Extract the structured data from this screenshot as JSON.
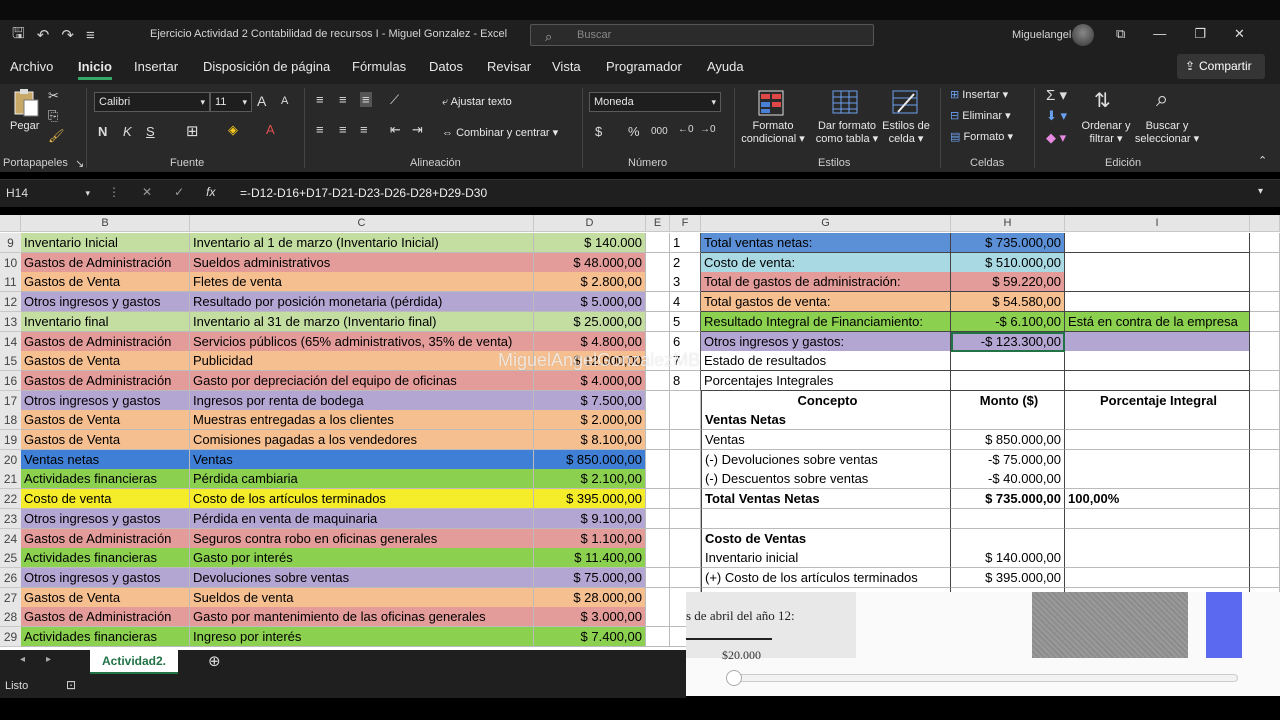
{
  "window": {
    "title": "Ejercicio Actividad 2 Contabilidad de recursos I - Miguel Gonzalez - Excel",
    "search_placeholder": "Buscar",
    "user": "Miguelangel Gz"
  },
  "menu": {
    "tabs": [
      "Archivo",
      "Inicio",
      "Insertar",
      "Disposición de página",
      "Fórmulas",
      "Datos",
      "Revisar",
      "Vista",
      "Programador",
      "Ayuda"
    ],
    "share": "Compartir"
  },
  "ribbon": {
    "paste": "Pegar",
    "font_name": "Calibri",
    "font_size": "11",
    "bold": "N",
    "italic": "K",
    "underline": "S",
    "wrap_text": "Ajustar texto",
    "merge_center": "Combinar y centrar",
    "number_format": "Moneda",
    "cond_format": [
      "Formato",
      "condicional"
    ],
    "format_table": [
      "Dar formato",
      "como tabla"
    ],
    "cell_styles": [
      "Estilos de",
      "celda"
    ],
    "insert": "Insertar",
    "delete": "Eliminar",
    "format": "Formato",
    "sort_filter": [
      "Ordenar y",
      "filtrar"
    ],
    "find_select": [
      "Buscar y",
      "seleccionar"
    ],
    "groups": [
      "Portapapeles",
      "Fuente",
      "Alineación",
      "Número",
      "Estilos",
      "Celdas",
      "Edición"
    ]
  },
  "formula_bar": {
    "name_box": "H14",
    "fx": "fx",
    "formula": "=-D12-D16+D17-D21-D23-D26-D28+D29-D30"
  },
  "columns": [
    "B",
    "C",
    "D",
    "E",
    "F",
    "G",
    "H",
    "I"
  ],
  "rows": [
    {
      "num": "9",
      "b": "Inventario Inicial",
      "c": "Inventario al 1 de marzo (Inventario Inicial)",
      "d": "$ 140.000",
      "color": "#c4dea2",
      "f": "1",
      "g": "Total ventas netas:",
      "h": "$ 735.000,00",
      "i": "",
      "gcolor": "#5b8fd6"
    },
    {
      "num": "10",
      "b": "Gastos de Administración",
      "c": "Sueldos administrativos",
      "d": "$ 48.000,00",
      "color": "#e39c99",
      "f": "2",
      "g": "Costo de venta:",
      "h": "$ 510.000,00",
      "i": "",
      "gcolor": "#a9d9e3"
    },
    {
      "num": "11",
      "b": "Gastos de Venta",
      "c": "Fletes de venta",
      "d": "$ 2.800,00",
      "color": "#f5bf90",
      "f": "3",
      "g": "Total de gastos de administración:",
      "h": "$ 59.220,00",
      "i": "",
      "gcolor": "#e39c99"
    },
    {
      "num": "12",
      "b": "Otros ingresos y gastos",
      "c": "Resultado por posición monetaria (pérdida)",
      "d": "$ 5.000,00",
      "color": "#b4a6d3",
      "f": "4",
      "g": "Total gastos de venta:",
      "h": "$ 54.580,00",
      "i": "",
      "gcolor": "#f5bf90"
    },
    {
      "num": "13",
      "b": "Inventario final",
      "c": "Inventario al 31 de marzo (Inventario final)",
      "d": "$ 25.000,00",
      "color": "#c4dea2",
      "f": "5",
      "g": "Resultado Integral de Financiamiento:",
      "h": "-$ 6.100,00",
      "i": "Está en contra de la empresa",
      "gcolor": "#8bd04f"
    },
    {
      "num": "14",
      "b": "Gastos de Administración",
      "c": "Servicios públicos (65% administrativos, 35% de venta)",
      "d": "$ 4.800,00",
      "color": "#e39c99",
      "f": "6",
      "g": "Otros ingresos y gastos:",
      "h": "-$ 123.300,00",
      "i": "",
      "gcolor": "#b4a6d3"
    },
    {
      "num": "15",
      "b": "Gastos de Venta",
      "c": "Publicidad",
      "d": "$ 12.000,00",
      "color": "#f5bf90",
      "f": "7",
      "g": "Estado de resultados",
      "h": "",
      "i": "",
      "gcolor": "#ffffff"
    },
    {
      "num": "16",
      "b": "Gastos de Administración",
      "c": "Gasto por depreciación del equipo de oficinas",
      "d": "$ 4.000,00",
      "color": "#e39c99",
      "f": "8",
      "g": "Porcentajes Integrales",
      "h": "",
      "i": "",
      "gcolor": "#ffffff"
    },
    {
      "num": "17",
      "b": "Otros ingresos y gastos",
      "c": "Ingresos por renta de bodega",
      "d": "$ 7.500,00",
      "color": "#b4a6d3",
      "f": "",
      "g": "Concepto",
      "h": "Monto ($)",
      "i": "Porcentaje Integral",
      "gcolor": "#ffffff"
    },
    {
      "num": "18",
      "b": "Gastos de Venta",
      "c": "Muestras entregadas a los clientes",
      "d": "$ 2.000,00",
      "color": "#f5bf90",
      "f": "",
      "g": "Ventas Netas",
      "h": "",
      "i": "",
      "gcolor": "#ffffff"
    },
    {
      "num": "19",
      "b": "Gastos de Venta",
      "c": "Comisiones pagadas a los vendedores",
      "d": "$ 8.100,00",
      "color": "#f5bf90",
      "f": "",
      "g": "Ventas",
      "h": "$ 850.000,00",
      "i": "",
      "gcolor": "#ffffff"
    },
    {
      "num": "20",
      "b": "Ventas netas",
      "c": "Ventas",
      "d": "$ 850.000,00",
      "color": "#3f7fd6",
      "f": "",
      "g": "(-) Devoluciones sobre ventas",
      "h": "-$ 75.000,00",
      "i": "",
      "gcolor": "#ffffff"
    },
    {
      "num": "21",
      "b": "Actividades financieras",
      "c": "Pérdida cambiaria",
      "d": "$ 2.100,00",
      "color": "#8bd04f",
      "f": "",
      "g": "(-) Descuentos sobre ventas",
      "h": "-$ 40.000,00",
      "i": "",
      "gcolor": "#ffffff"
    },
    {
      "num": "22",
      "b": "Costo de venta",
      "c": "Costo de los artículos terminados",
      "d": "$ 395.000,00",
      "color": "#f5ec2a",
      "f": "",
      "g": "Total Ventas Netas",
      "h": "$ 735.000,00",
      "i": "100,00%",
      "gcolor": "#ffffff"
    },
    {
      "num": "23",
      "b": "Otros ingresos y gastos",
      "c": "Pérdida en venta de maquinaria",
      "d": "$ 9.100,00",
      "color": "#b4a6d3",
      "f": "",
      "g": "",
      "h": "",
      "i": "",
      "gcolor": "#ffffff"
    },
    {
      "num": "24",
      "b": "Gastos de Administración",
      "c": "Seguros contra robo en oficinas generales",
      "d": "$ 1.100,00",
      "color": "#e39c99",
      "f": "",
      "g": "Costo de Ventas",
      "h": "",
      "i": "",
      "gcolor": "#ffffff"
    },
    {
      "num": "25",
      "b": "Actividades financieras",
      "c": "Gasto por interés",
      "d": "$ 11.400,00",
      "color": "#8bd04f",
      "f": "",
      "g": "Inventario inicial",
      "h": "$ 140.000,00",
      "i": "",
      "gcolor": "#ffffff"
    },
    {
      "num": "26",
      "b": "Otros ingresos y gastos",
      "c": "Devoluciones sobre ventas",
      "d": "$ 75.000,00",
      "color": "#b4a6d3",
      "f": "",
      "g": "(+) Costo de los artículos terminados",
      "h": "$ 395.000,00",
      "i": "",
      "gcolor": "#ffffff"
    },
    {
      "num": "27",
      "b": "Gastos de Venta",
      "c": "Sueldos de venta",
      "d": "$ 28.000,00",
      "color": "#f5bf90",
      "f": "",
      "g": "",
      "h": "",
      "i": "",
      "gcolor": "#ffffff"
    },
    {
      "num": "28",
      "b": "Gastos de Administración",
      "c": "Gasto por mantenimiento de las oficinas generales",
      "d": "$ 3.000,00",
      "color": "#e39c99",
      "f": "",
      "g": "",
      "h": "",
      "i": "",
      "gcolor": "#ffffff"
    },
    {
      "num": "29",
      "b": "Actividades financieras",
      "c": "Ingreso por interés",
      "d": "$ 7.400,00",
      "color": "#8bd04f",
      "f": "",
      "g": "",
      "h": "",
      "i": "",
      "gcolor": "#ffffff"
    }
  ],
  "watermark": "MiguelAngelGonzalezMB",
  "overlay": {
    "doc_text": "s de abril del año 12:",
    "doc_number": "$20.000"
  },
  "sheet_tab": "Actividad2.",
  "status": "Listo"
}
